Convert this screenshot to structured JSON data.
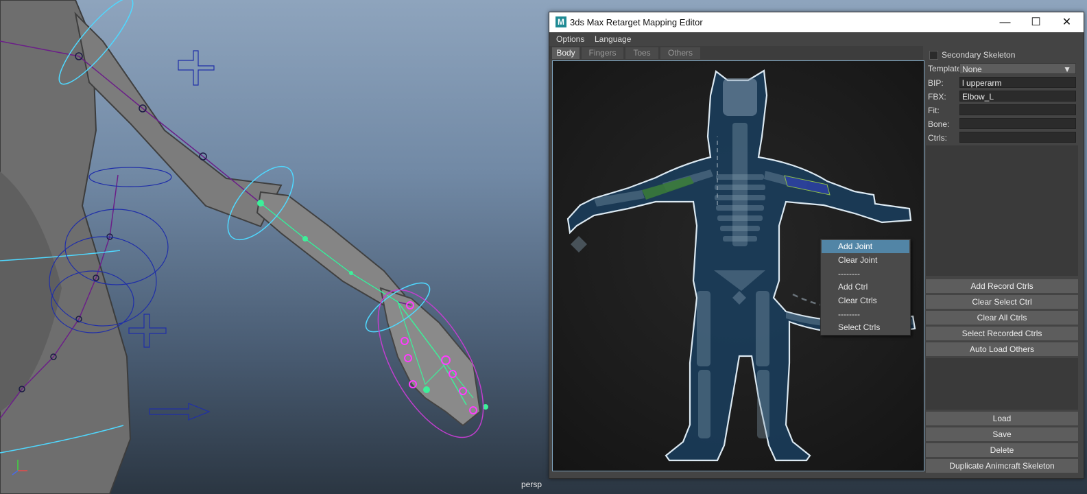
{
  "viewport": {
    "camera_label": "persp"
  },
  "window": {
    "title": "3ds Max Retarget Mapping Editor",
    "icon_letter": "M",
    "controls": {
      "minimize": "—",
      "maximize": "☐",
      "close": "✕"
    }
  },
  "menu": {
    "options": "Options",
    "language": "Language"
  },
  "tabs": [
    "Body",
    "Fingers",
    "Toes",
    "Others"
  ],
  "active_tab": "Body",
  "context_menu": {
    "items": [
      "Add Joint",
      "Clear Joint",
      "--------",
      "Add Ctrl",
      "Clear Ctrls",
      "--------",
      "Select Ctrls"
    ],
    "highlighted": "Add Joint"
  },
  "panel": {
    "secondary_skeleton_label": "Secondary Skeleton",
    "secondary_skeleton_checked": false,
    "template_label": "Template",
    "template_value": "None",
    "bip_label": "BIP:",
    "bip_value": "l upperarm",
    "fbx_label": "FBX:",
    "fbx_value": "Elbow_L",
    "fit_label": "Fit:",
    "fit_value": "",
    "bone_label": "Bone:",
    "bone_value": "",
    "ctrls_label": "Ctrls:",
    "ctrls_value": "",
    "buttons_top": [
      "Add Record Ctrls",
      "Clear Select Ctrl",
      "Clear All Ctrls",
      "Select Recorded Ctrls",
      "Auto Load Others"
    ],
    "buttons_bottom": [
      "Load",
      "Save",
      "Delete",
      "Duplicate Animcraft Skeleton"
    ]
  },
  "colors": {
    "accent": "#5285a6",
    "viewport_sky": "#8ea4bd",
    "silhouette": "#1a3e5e",
    "highlight_left_upperarm": "#3a7a3a",
    "highlight_right_upperarm": "#2a3f9a"
  }
}
